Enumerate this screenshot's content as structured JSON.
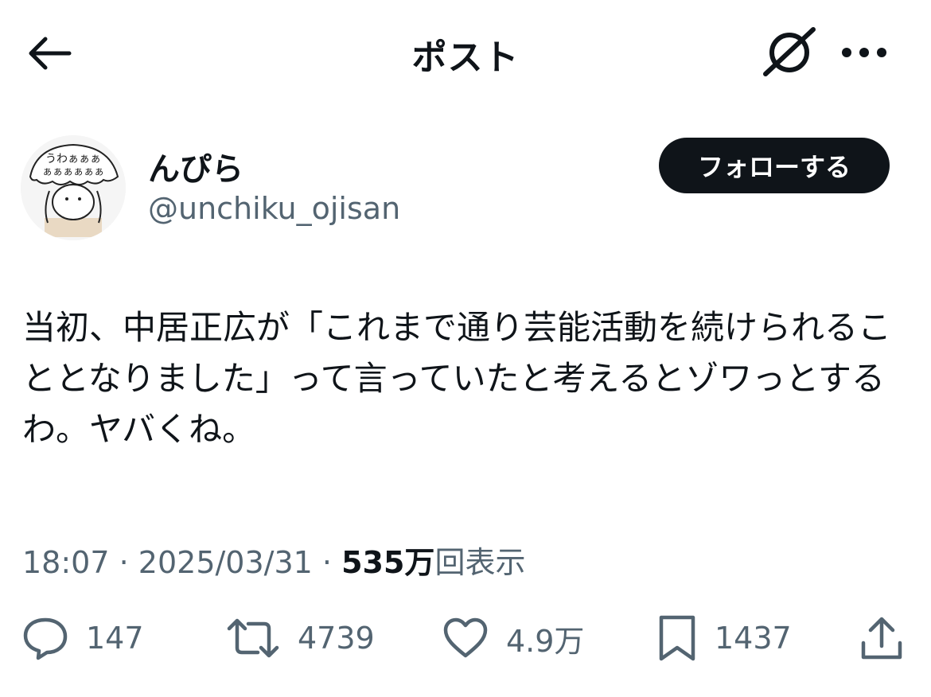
{
  "header": {
    "title": "ポスト"
  },
  "author": {
    "display_name": "んぴら",
    "handle": "@unchiku_ojisan",
    "follow_label": "フォローする",
    "avatar_text_line1": "うわぁぁぁ",
    "avatar_text_line2": "ぁぁぁぁぁぁ"
  },
  "post": {
    "text": "当初、中居正広が「これまで通り芸能活動を続けられることとなりました」って言っていたと考えるとゾワっとするわ。ヤバくね。"
  },
  "meta": {
    "time": "18:07",
    "separator": "·",
    "date": "2025/03/31",
    "views_count": "535万",
    "views_label": "回表示"
  },
  "actions": {
    "replies": "147",
    "retweets": "4739",
    "likes": "4.9万",
    "bookmarks": "1437"
  },
  "icons": {
    "back": "back-arrow-icon",
    "grok": "grok-icon",
    "more": "more-icon",
    "reply": "reply-icon",
    "retweet": "retweet-icon",
    "like": "heart-icon",
    "bookmark": "bookmark-icon",
    "share": "share-icon"
  },
  "colors": {
    "text": "#0f1419",
    "secondary": "#536471",
    "follow_bg": "#0f1419",
    "follow_text": "#ffffff"
  }
}
